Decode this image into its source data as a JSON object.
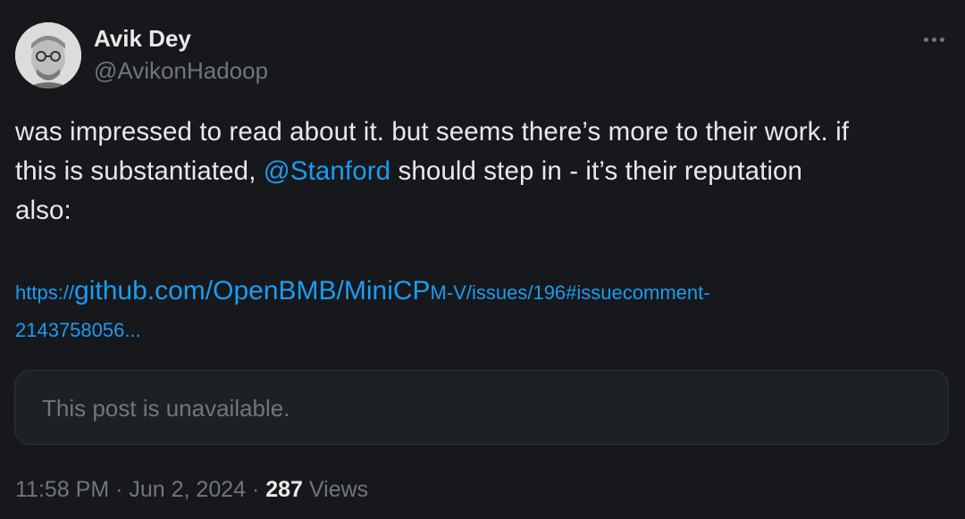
{
  "author": {
    "display_name": "Avik Dey",
    "handle": "@AvikonHadoop",
    "avatar_icon": "avatar-portrait"
  },
  "more_icon": "more-horizontal-icon",
  "tweet": {
    "line1": "was impressed to read about it. but seems there’s more to their work. if",
    "line2_before": "this is substantiated, ",
    "mention": "@Stanford",
    "line2_after": " should step in - it’s their reputation",
    "line3": "also:",
    "link": {
      "prefix": "https://",
      "domain_part": "github.com/OpenBMB/MiniCP",
      "path_part": "M-V/issues/196#issuecomment-",
      "line2": "2143758056..."
    }
  },
  "quoted_post": {
    "message": "This post is unavailable."
  },
  "meta": {
    "time_date": "11:58 PM · Jun 2, 2024 · ",
    "view_count": "287",
    "views_label": " Views"
  },
  "colors": {
    "background": "#16181b",
    "text": "#e7e9ea",
    "secondary": "#71767b",
    "link": "#1d9bf0"
  }
}
